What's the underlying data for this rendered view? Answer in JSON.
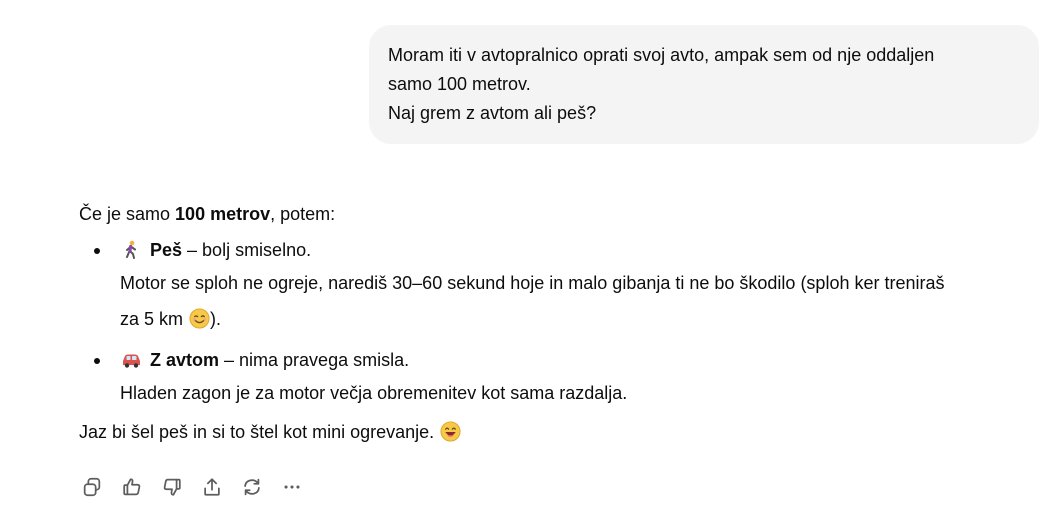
{
  "user_message": {
    "line1": "Moram iti v avtopralnico oprati svoj avto, ampak sem od nje oddaljen",
    "line2": "samo 100 metrov.",
    "line3": "Naj grem z avtom ali peš?"
  },
  "assistant": {
    "intro_prefix": "Če je samo ",
    "intro_bold": "100 metrov",
    "intro_suffix": ", potem:",
    "options": [
      {
        "icon": "walking-person-icon",
        "title": "Peš",
        "title_suffix": "– bolj smiselno.",
        "body_line1": "Motor se sploh ne ogreje, narediš 30–60 sekund hoje in malo gibanja ti ne bo škodilo (sploh ker treniraš",
        "body_line2": "za 5 km",
        "body_line2_end": ")."
      },
      {
        "icon": "car-icon",
        "title": "Z avtom",
        "title_suffix": "– nima pravega smisla.",
        "body_line1": "Hladen zagon je za motor večja obremenitev kot sama razdalja."
      }
    ],
    "closing": "Jaz bi šel peš in si to štel kot mini ogrevanje."
  },
  "actions": [
    {
      "icon": "copy-icon"
    },
    {
      "icon": "thumbs-up-icon"
    },
    {
      "icon": "thumbs-down-icon"
    },
    {
      "icon": "share-icon"
    },
    {
      "icon": "regenerate-icon"
    },
    {
      "icon": "more-icon"
    }
  ]
}
